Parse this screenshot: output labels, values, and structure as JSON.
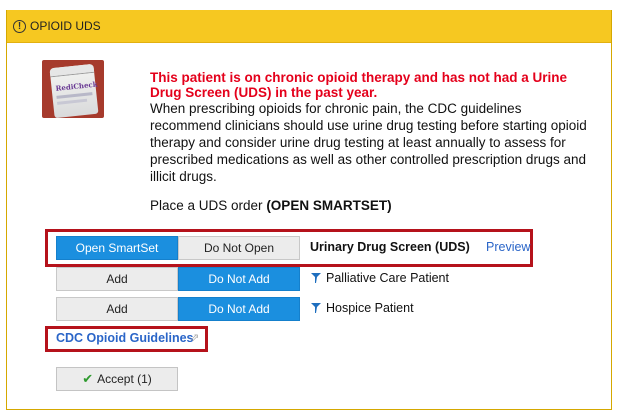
{
  "header": {
    "title": "OPIOID UDS",
    "icon": "exclamation-circle-icon"
  },
  "alert": {
    "headline": "This patient is on chronic opioid therapy and has not had a Urine Drug Screen (UDS)  in the past year.",
    "body": "When prescribing opioids for chronic pain, the CDC guidelines recommend clinicians should use urine drug testing before starting opioid therapy and consider urine drug testing at least annually to assess for prescribed medications as well as other controlled prescription drugs and illicit drugs.",
    "order_prefix": "Place a  UDS order ",
    "order_bold": "(OPEN SMARTSET)"
  },
  "rows": [
    {
      "primary": "Open SmartSet",
      "secondary": "Do Not Open",
      "label": "Urinary Drug Screen (UDS)",
      "link": "Preview"
    },
    {
      "primary": "Add",
      "secondary": "Do Not Add",
      "label": "Palliative Care Patient"
    },
    {
      "primary": "Add",
      "secondary": "Do Not Add",
      "label": "Hospice Patient"
    }
  ],
  "guidelines_link": "CDC Opioid Guidelines",
  "accept_label": "Accept (1)",
  "colors": {
    "header": "#f6c821",
    "alert": "#e4001b",
    "selected": "#1b8fdf",
    "highlight": "#b5121b",
    "link": "#2a65c8"
  }
}
